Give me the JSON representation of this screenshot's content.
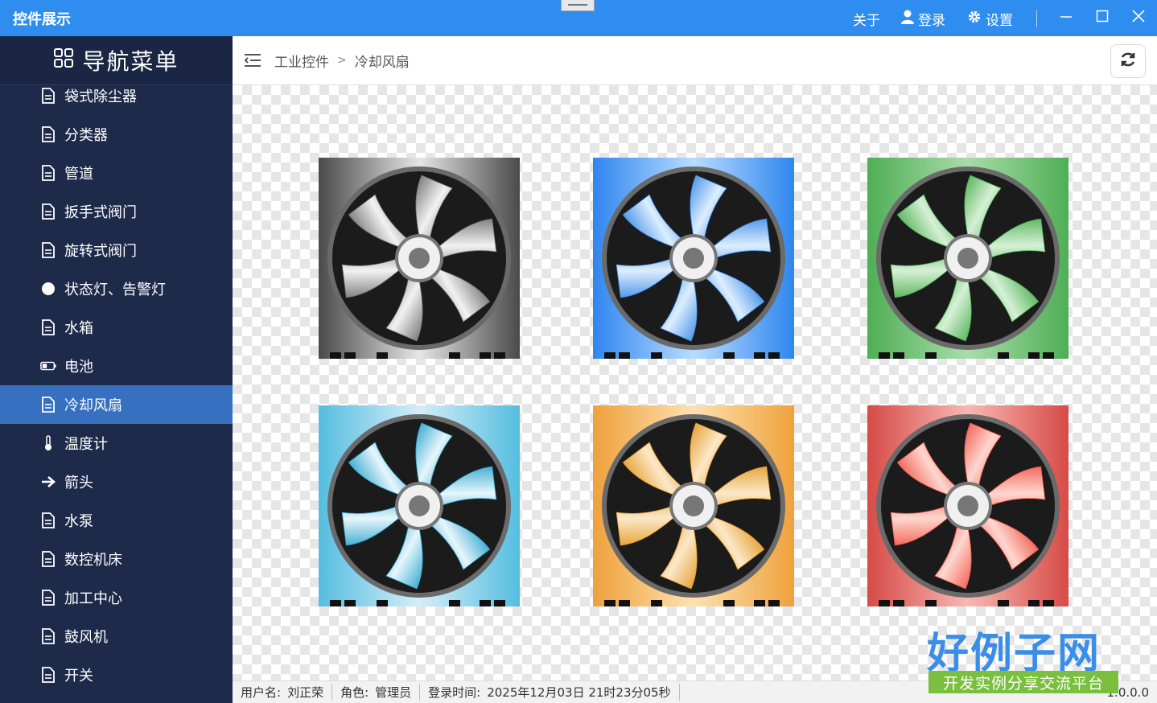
{
  "window": {
    "title": "控件展示",
    "about": "关于",
    "login": "登录",
    "settings": "设置"
  },
  "sidebar": {
    "title": "导航菜单",
    "items": [
      {
        "label": "袋式除尘器",
        "icon": "document-icon"
      },
      {
        "label": "分类器",
        "icon": "document-icon"
      },
      {
        "label": "管道",
        "icon": "document-icon"
      },
      {
        "label": "扳手式阀门",
        "icon": "document-icon"
      },
      {
        "label": "旋转式阀门",
        "icon": "document-icon"
      },
      {
        "label": "状态灯、告警灯",
        "icon": "dot-icon"
      },
      {
        "label": "水箱",
        "icon": "document-icon"
      },
      {
        "label": "电池",
        "icon": "battery-icon"
      },
      {
        "label": "冷却风扇",
        "icon": "document-icon",
        "active": true
      },
      {
        "label": "温度计",
        "icon": "thermometer-icon"
      },
      {
        "label": "箭头",
        "icon": "arrow-right-icon"
      },
      {
        "label": "水泵",
        "icon": "document-icon"
      },
      {
        "label": "数控机床",
        "icon": "document-icon"
      },
      {
        "label": "加工中心",
        "icon": "document-icon"
      },
      {
        "label": "鼓风机",
        "icon": "document-icon"
      },
      {
        "label": "开关",
        "icon": "document-icon"
      }
    ]
  },
  "breadcrumb": {
    "root": "工业控件",
    "current": "冷却风扇"
  },
  "fans": [
    {
      "color_name": "gray",
      "light": "#f2f2f2",
      "dark": "#6e6e6e",
      "bg_light": "#e6e6e6",
      "bg_dark": "#4a4a4a"
    },
    {
      "color_name": "blue",
      "light": "#dceeff",
      "dark": "#3d8be6",
      "bg_light": "#b9dcff",
      "bg_dark": "#2f86ee"
    },
    {
      "color_name": "green",
      "light": "#d6f0d6",
      "dark": "#4caf50",
      "bg_light": "#a9dca9",
      "bg_dark": "#4fae55"
    },
    {
      "color_name": "cyan",
      "light": "#e6f6fb",
      "dark": "#2aa3cc",
      "bg_light": "#d4eef8",
      "bg_dark": "#55bde0"
    },
    {
      "color_name": "orange",
      "light": "#fbe8c8",
      "dark": "#e49a26",
      "bg_light": "#fde1b0",
      "bg_dark": "#efa13c"
    },
    {
      "color_name": "red",
      "light": "#ffd7cf",
      "dark": "#f0574a",
      "bg_light": "#f7b8b3",
      "bg_dark": "#d74b47"
    }
  ],
  "status": {
    "user_label": "用户名:",
    "user": "刘正荣",
    "role_label": "角色:",
    "role": "管理员",
    "login_time_label": "登录时间:",
    "login_time": "2025年12月03日 21时23分05秒",
    "version": "1.0.0.0"
  },
  "watermark": {
    "title": "好例子网",
    "subtitle": "开发实例分享交流平台"
  }
}
